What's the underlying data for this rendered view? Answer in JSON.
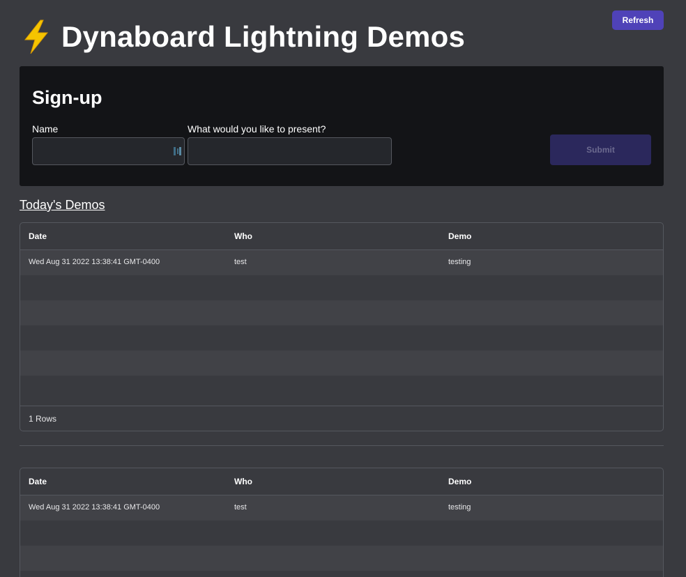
{
  "header": {
    "title": "Dynaboard Lightning Demos",
    "refresh_label": "Refresh"
  },
  "signup": {
    "title": "Sign-up",
    "name_label": "Name",
    "name_value": "",
    "present_label": "What would you like to present?",
    "present_value": "",
    "submit_label": "Submit"
  },
  "section": {
    "title": "Today's Demos"
  },
  "table": {
    "columns": [
      "Date",
      "Who",
      "Demo"
    ],
    "rows": [
      {
        "date": "Wed Aug 31 2022 13:38:41 GMT-0400",
        "who": "test",
        "demo": "testing"
      }
    ],
    "row_count": "1 Rows"
  },
  "colors": {
    "background": "#393a3f",
    "card": "#131417",
    "accent": "#4f42b8",
    "bolt": "#f5c400"
  },
  "icons": {
    "title": "lightning-bolt-icon",
    "autofill": "password-manager-icon"
  }
}
